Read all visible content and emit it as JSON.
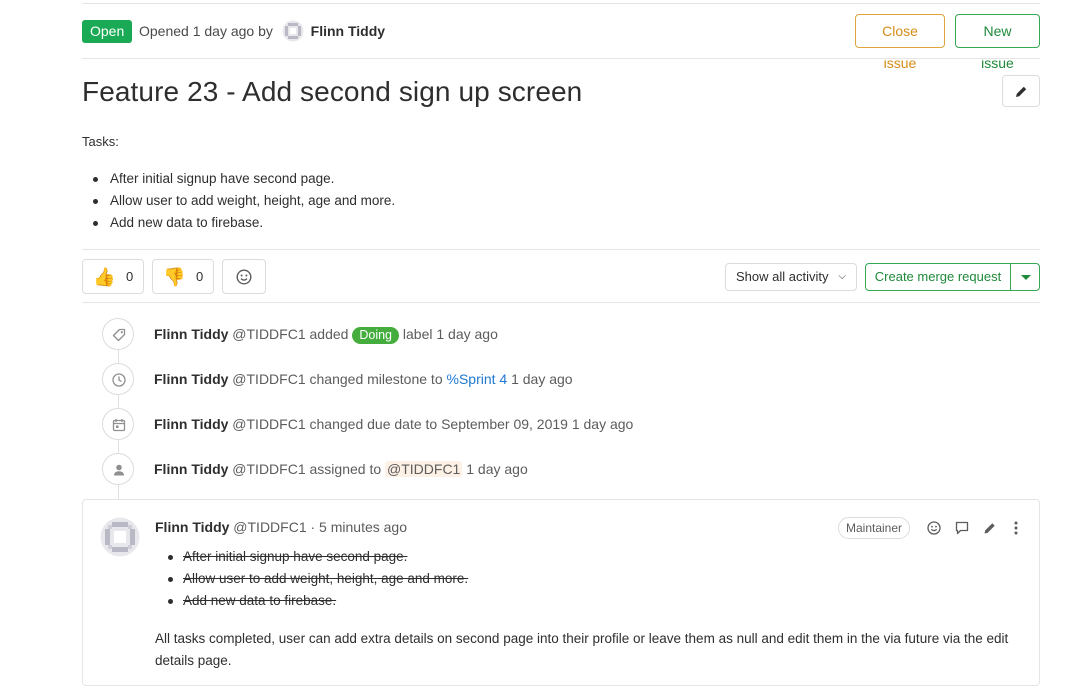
{
  "header": {
    "status": "Open",
    "opened_prefix": "Opened 1 day ago by",
    "author": "Flinn Tiddy",
    "close_label": "Close issue",
    "new_label": "New issue"
  },
  "issue": {
    "title": "Feature 23 - Add second sign up screen",
    "tasks_label": "Tasks:",
    "tasks": [
      "After initial signup have second page.",
      "Allow user to add weight, height, age and more.",
      "Add new data to firebase."
    ]
  },
  "awards": {
    "thumbsup_count": "0",
    "thumbsdown_count": "0"
  },
  "activity": {
    "filter_label": "Show all activity",
    "merge_label": "Create merge request"
  },
  "timeline": [
    {
      "icon": "tag-icon",
      "user": "Flinn Tiddy",
      "handle": "@TIDDFC1",
      "pre": "added",
      "label": "Doing",
      "post": "label 1 day ago"
    },
    {
      "icon": "clock-icon",
      "user": "Flinn Tiddy",
      "handle": "@TIDDFC1",
      "pre": "changed milestone to",
      "link": "%Sprint 4",
      "post": "1 day ago"
    },
    {
      "icon": "calendar-icon",
      "user": "Flinn Tiddy",
      "handle": "@TIDDFC1",
      "pre": "changed due date to September 09, 2019 1 day ago"
    },
    {
      "icon": "user-icon",
      "user": "Flinn Tiddy",
      "handle": "@TIDDFC1",
      "pre": "assigned to",
      "ref": "@TIDDFC1",
      "post": "1 day ago"
    }
  ],
  "comment": {
    "user": "Flinn Tiddy",
    "handle_time": "@TIDDFC1 · 5 minutes ago",
    "role": "Maintainer",
    "done_tasks": [
      "After initial signup have second page.",
      "Allow user to add weight, height, age and more.",
      "Add new data to firebase."
    ],
    "body": "All tasks completed, user can add extra details on second page into their profile or leave them as null and edit them in the via future via the edit details page."
  },
  "colors": {
    "open_green": "#1aaa55",
    "label_doing": "#44ad3e",
    "close_orange": "#d68c19",
    "link_blue": "#1f78d1"
  }
}
